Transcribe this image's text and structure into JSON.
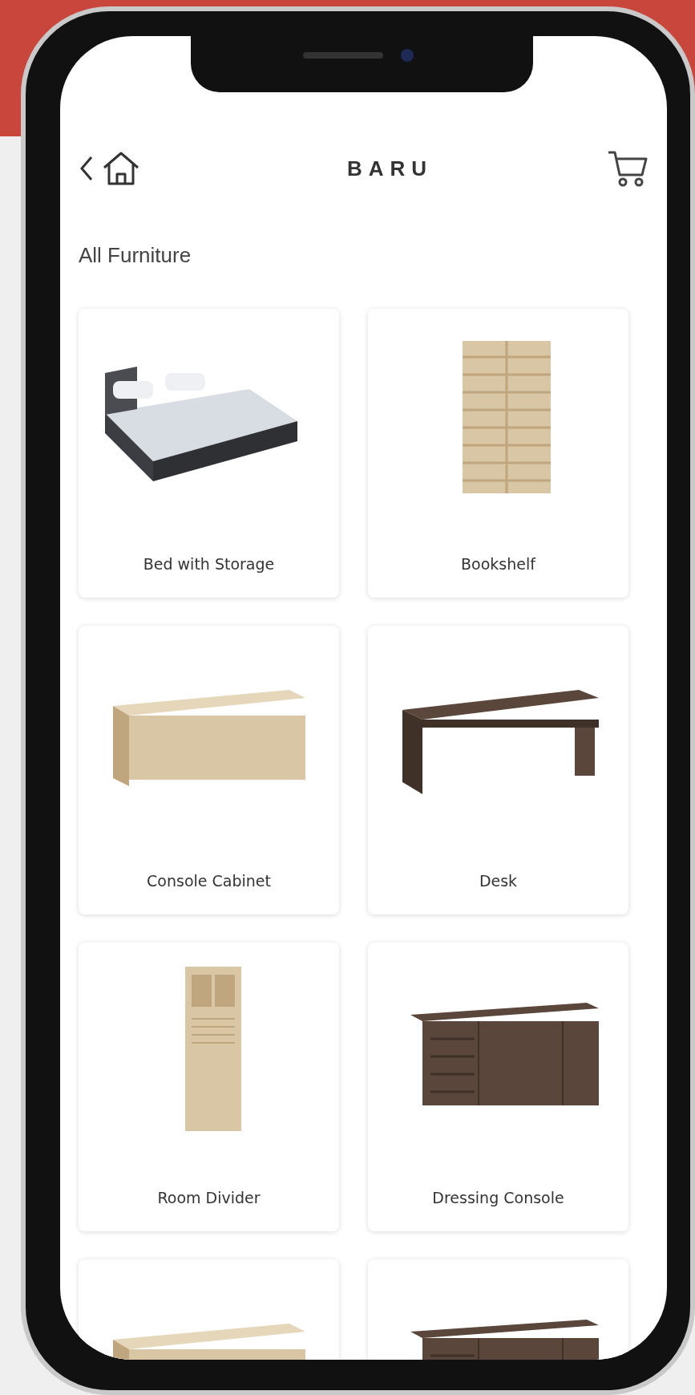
{
  "header": {
    "logo": "BARU"
  },
  "title": "All Furniture",
  "products": [
    {
      "kind": "bed",
      "label": "Bed with Storage"
    },
    {
      "kind": "bookshelf",
      "label": "Bookshelf"
    },
    {
      "kind": "cabinet",
      "label": "Console Cabinet"
    },
    {
      "kind": "desk",
      "label": "Desk"
    },
    {
      "kind": "divider",
      "label": "Room Divider"
    },
    {
      "kind": "console",
      "label": "Dressing Console"
    },
    {
      "kind": "cabinet"
    },
    {
      "kind": "console"
    }
  ]
}
